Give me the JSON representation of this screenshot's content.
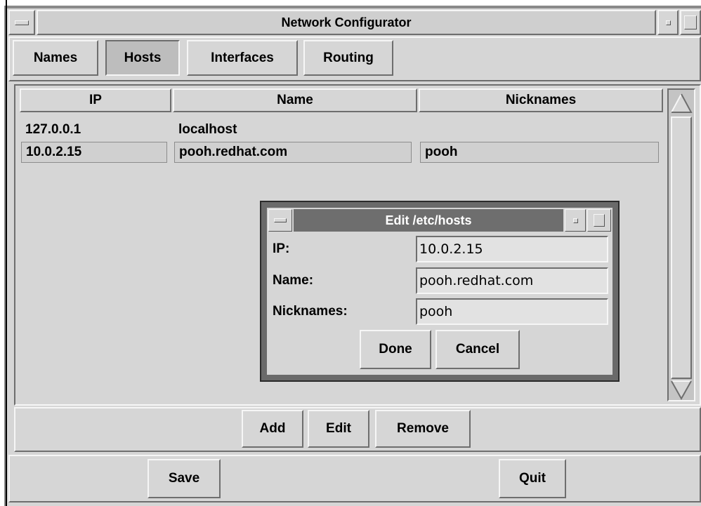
{
  "window": {
    "title": "Network Configurator"
  },
  "tabs": [
    {
      "label": "Names"
    },
    {
      "label": "Hosts",
      "selected": true
    },
    {
      "label": "Interfaces"
    },
    {
      "label": "Routing"
    }
  ],
  "hosts_table": {
    "columns": [
      "IP",
      "Name",
      "Nicknames"
    ],
    "rows": [
      {
        "ip": "127.0.0.1",
        "name": "localhost",
        "nicknames": ""
      },
      {
        "ip": "10.0.2.15",
        "name": "pooh.redhat.com",
        "nicknames": "pooh",
        "selected": true
      }
    ]
  },
  "table_actions": {
    "add": "Add",
    "edit": "Edit",
    "remove": "Remove"
  },
  "footer": {
    "save": "Save",
    "quit": "Quit"
  },
  "dialog": {
    "title": "Edit /etc/hosts",
    "ip_label": "IP:",
    "ip_value": "10.0.2.15",
    "name_label": "Name:",
    "name_value": "pooh.redhat.com",
    "nicknames_label": "Nicknames:",
    "nicknames_value": "pooh",
    "done": "Done",
    "cancel": "Cancel"
  },
  "icons": {
    "window_menu": "window-menu-icon",
    "minimize": "minimize-icon",
    "maximize": "maximize-icon",
    "scroll_up": "scroll-up-arrow-icon",
    "scroll_down": "scroll-down-arrow-icon"
  }
}
